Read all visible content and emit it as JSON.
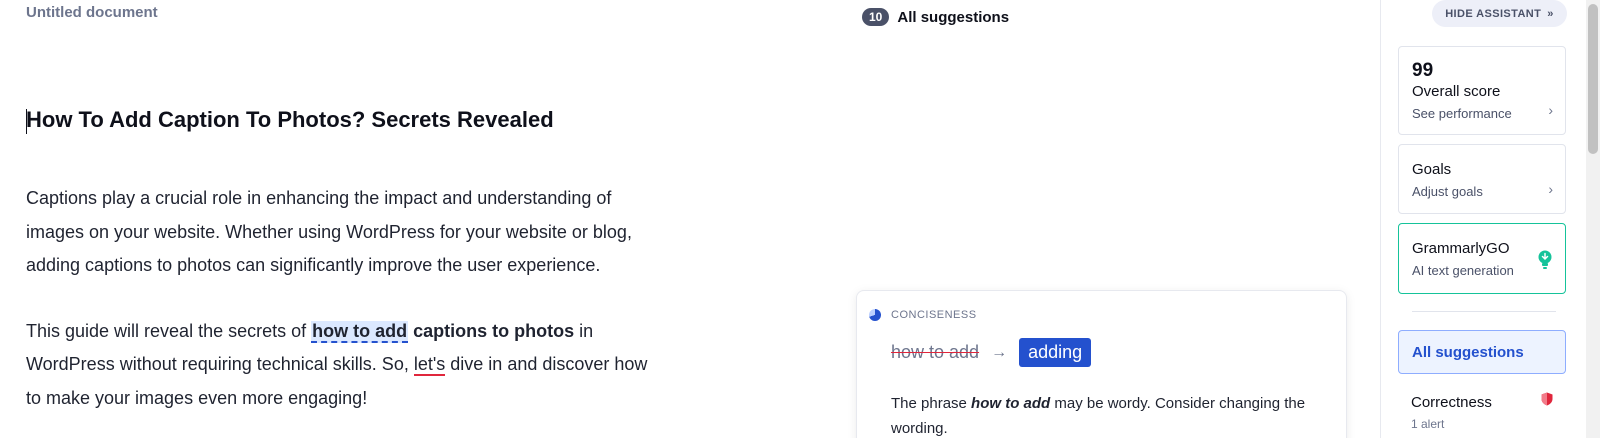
{
  "document": {
    "title": "Untitled document",
    "heading": "How To Add Caption To Photos? Secrets Revealed",
    "para1": "Captions play a crucial role in enhancing the impact and understanding of images on your website. Whether using WordPress for your website or blog, adding captions to photos can significantly improve the user experience.",
    "para2_before": "This guide will reveal the secrets of ",
    "para2_highlight": "how to add",
    "para2_bold": " captions to photos",
    "para2_mid": " in WordPress without requiring technical skills. So, ",
    "para2_error": "let's",
    "para2_after": " dive in and discover how to make your images even more engaging!"
  },
  "suggestions": {
    "count": "10",
    "title": "All suggestions"
  },
  "card": {
    "category": "CONCISENESS",
    "old_text": "how to add",
    "arrow": "→",
    "new_text": "adding",
    "desc_before": "The phrase ",
    "desc_em": "how to add",
    "desc_after": " may be wordy. Consider changing the wording."
  },
  "sidebar": {
    "hide_label": "HIDE ASSISTANT",
    "hide_icon": "»",
    "score": "99",
    "score_title": "Overall score",
    "score_sub": "See performance",
    "goals_title": "Goals",
    "goals_sub": "Adjust goals",
    "go_title": "GrammarlyGO",
    "go_sub": "AI text generation",
    "all_suggestions": "All suggestions",
    "correctness_title": "Correctness",
    "correctness_sub": "1 alert",
    "chevron": "›"
  },
  "colors": {
    "accent": "#2451ce",
    "go_green": "#15c39a",
    "error_red": "#e0263c"
  }
}
